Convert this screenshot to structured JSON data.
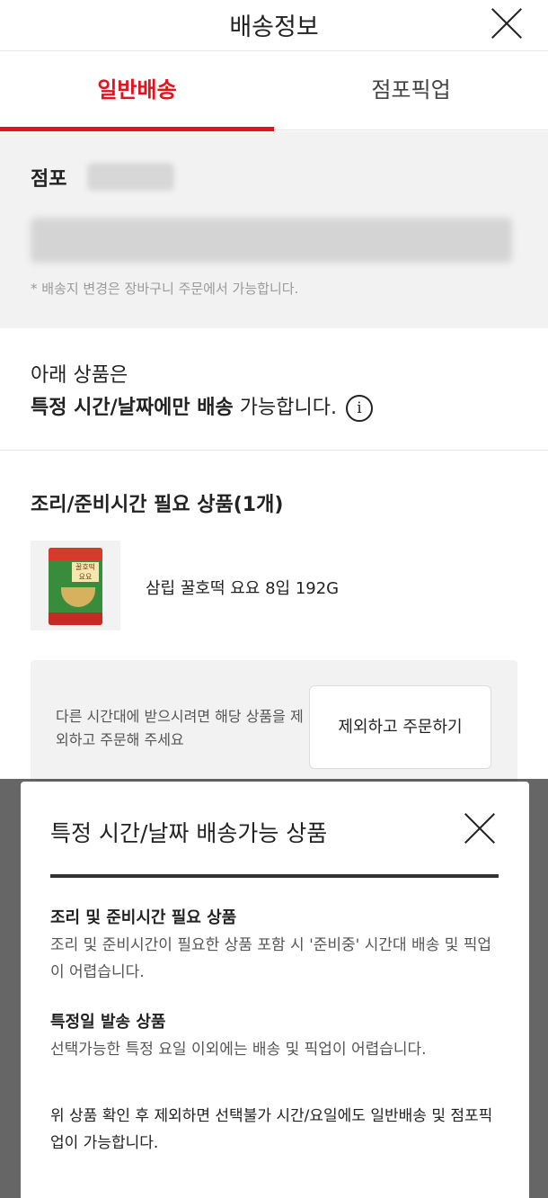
{
  "header": {
    "title": "배송정보"
  },
  "tabs": [
    {
      "label": "일반배송"
    },
    {
      "label": "점포픽업"
    }
  ],
  "store": {
    "label": "점포",
    "note": "* 배송지 변경은 장바구니 주문에서 가능합니다."
  },
  "notice": {
    "line1": "아래 상품은",
    "bold": "특정 시간/날짜에만 배송",
    "rest": " 가능합니다.",
    "info_symbol": "i"
  },
  "section": {
    "title": "조리/준비시간 필요 상품(1개)"
  },
  "product": {
    "name": "삼립 꿀호떡 요요 8입 192G",
    "package_text": "꿀호떡 요요"
  },
  "exclude": {
    "text": "다른 시간대에 받으시려면 해당 상품을 제외하고 주문해 주세요",
    "button_label": "제외하고 주문하기"
  },
  "sheet": {
    "title": "특정 시간/날짜 배송가능 상품",
    "sections": [
      {
        "heading": "조리 및 준비시간 필요 상품",
        "body": "조리 및 준비시간이 필요한 상품 포함 시 '준비중' 시간대 배송 및 픽업이 어렵습니다."
      },
      {
        "heading": "특정일 발송 상품",
        "body": "선택가능한 특정 요일 이외에는 배송 및 픽업이 어렵습니다."
      }
    ],
    "footer": "위 상품 확인 후 제외하면 선택불가 시간/요일에도 일반배송 및 점포픽업이 가능합니다."
  },
  "colors": {
    "accent": "#e0141e",
    "gray_bg": "#f2f2f2"
  }
}
